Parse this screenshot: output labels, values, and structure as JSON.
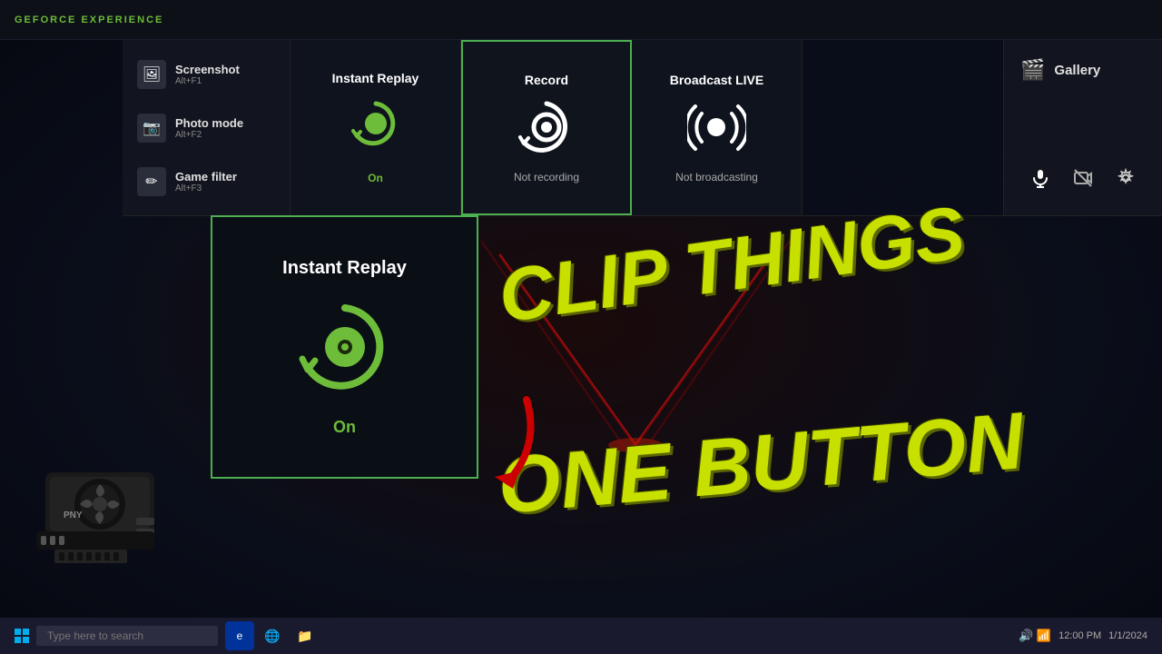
{
  "gfe": {
    "logo": "GEFORCE EXPERIENCE"
  },
  "top_bar": {
    "left_items": [
      {
        "label": "Screenshot",
        "shortcut": "Alt+F1",
        "icon": "🖼"
      },
      {
        "label": "Photo mode",
        "shortcut": "Alt+F2",
        "icon": "📷"
      },
      {
        "label": "Game filter",
        "shortcut": "Alt+F3",
        "icon": "🎮"
      }
    ],
    "panels": [
      {
        "id": "instant-replay",
        "title": "Instant Replay",
        "status": "On",
        "status_type": "on"
      },
      {
        "id": "record",
        "title": "Record",
        "status": "Not recording",
        "status_type": "inactive"
      },
      {
        "id": "broadcast",
        "title": "Broadcast LIVE",
        "status": "Not broadcasting",
        "status_type": "inactive"
      }
    ],
    "gallery": {
      "label": "Gallery",
      "icon": "🎬"
    },
    "controls": [
      {
        "id": "mic",
        "icon": "🎤"
      },
      {
        "id": "cam",
        "icon": "📵"
      },
      {
        "id": "settings",
        "icon": "⚙"
      }
    ]
  },
  "instant_replay_expanded": {
    "title": "Instant Replay",
    "status": "On"
  },
  "overlay_text": {
    "clip_things": "CLIP THINGS",
    "one_button": "ONE BUTTON"
  },
  "taskbar": {
    "search_placeholder": "Type here to search",
    "time": "12:00 PM",
    "date": "1/1/2024"
  }
}
